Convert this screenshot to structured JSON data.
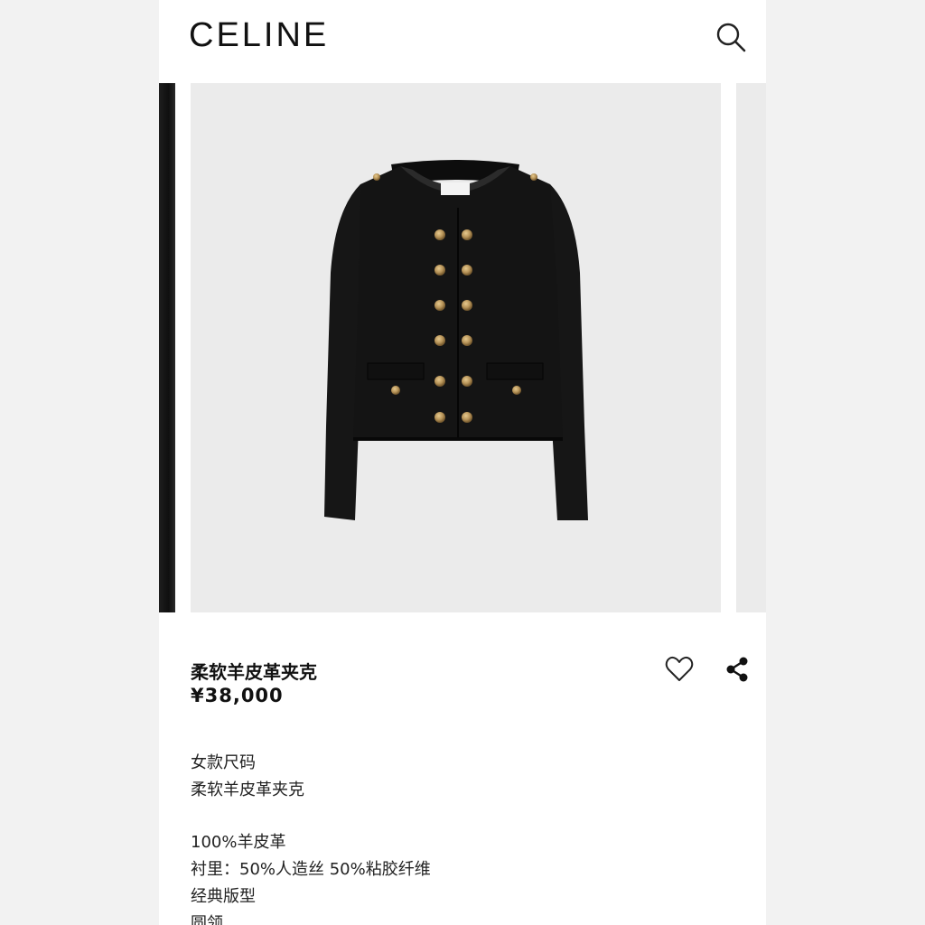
{
  "header": {
    "brand": "CELINE",
    "search_icon": "search-icon"
  },
  "product": {
    "name": "柔软羊皮革夹克",
    "price": "¥38,000",
    "wishlist_icon": "heart-icon",
    "share_icon": "share-icon"
  },
  "description": {
    "block1": [
      "女款尺码",
      "柔软羊皮革夹克"
    ],
    "block2": [
      "100%羊皮革",
      "衬里：50%人造丝 50%粘胶纤维",
      "经典版型",
      "圆领"
    ]
  },
  "colors": {
    "image_background": "#ebebeb",
    "jacket": "#141414",
    "buttons": "#b8955a"
  }
}
